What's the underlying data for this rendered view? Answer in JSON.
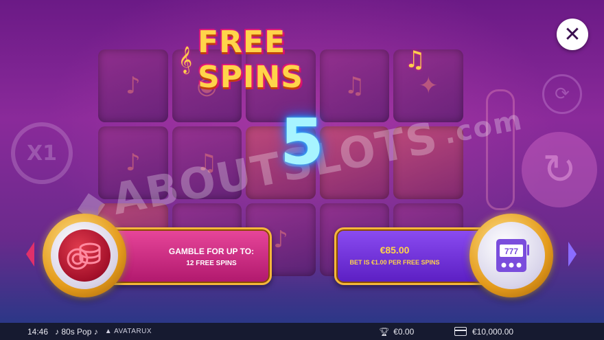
{
  "title": "FREE SPINS",
  "free_spins_count": "5",
  "watermark": {
    "brand": "ABOUTSLOTS",
    "tld": ".com"
  },
  "background": {
    "multiplier_label": "X1"
  },
  "gamble": {
    "title": "GAMBLE FOR UP TO:",
    "subtitle": "12 FREE SPINS"
  },
  "collect": {
    "value": "€85.00",
    "subtitle": "BET IS €1.00 PER FREE SPINS"
  },
  "status_bar": {
    "time": "14:46",
    "game_name": "♪ 80s Pop ♪",
    "provider": "AVATARUX",
    "win": "€0.00",
    "balance": "€10,000.00"
  },
  "icons": {
    "close": "close-icon",
    "chips": "poker-chips-icon",
    "slot": "slot-machine-icon",
    "trophy": "trophy-icon",
    "card": "credit-card-icon",
    "note": "music-note-icon"
  },
  "colors": {
    "title": "#ffd44a",
    "count_glow": "#1e90ff",
    "gamble_panel": "#d0307f",
    "collect_panel": "#6e2ed6",
    "panel_border": "#f5b73a"
  }
}
